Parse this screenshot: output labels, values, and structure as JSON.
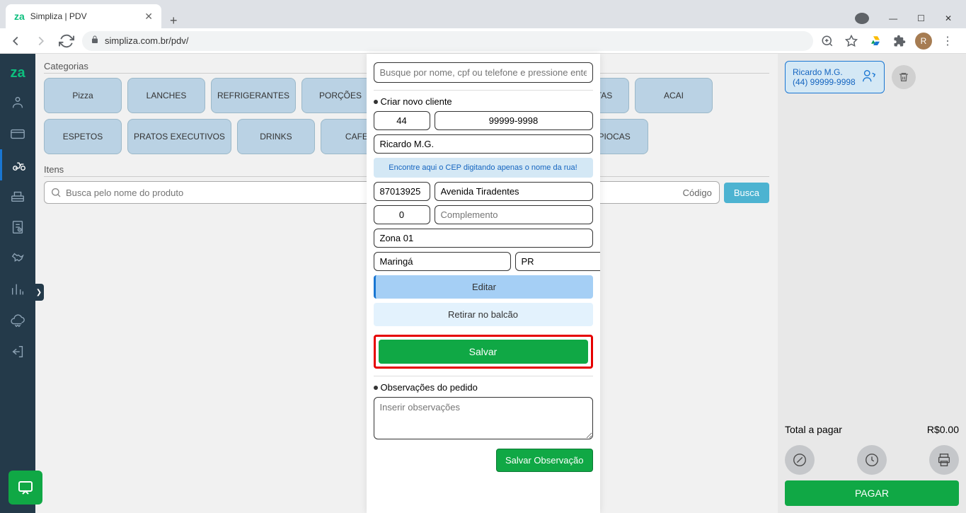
{
  "browser": {
    "tab_title": "Simpliza | PDV",
    "url": "simpliza.com.br/pdv/",
    "profile_letter": "R"
  },
  "sidebar": {
    "items": [
      "logo",
      "pos",
      "card",
      "delivery",
      "register",
      "receipt",
      "handshake",
      "reports",
      "cloud",
      "logout"
    ]
  },
  "main": {
    "categories_label": "Categorias",
    "items_label": "Itens",
    "categories": [
      "Pizza",
      "LANCHES",
      "REFRIGERANTES",
      "PORÇÕES",
      "MARMITAS",
      "ACAI",
      "ESPETOS",
      "PRATOS EXECUTIVOS",
      "DRINKS",
      "CAFES",
      "TAPIOCAS"
    ],
    "search_placeholder": "Busca pelo nome do produto",
    "code_label": "Código",
    "search_btn": "Busca"
  },
  "modal": {
    "search_placeholder": "Busque por nome, cpf ou telefone e pressione enter",
    "new_client_label": "Criar novo cliente",
    "ddd": "44",
    "phone": "99999-9998",
    "name": "Ricardo M.G.",
    "cep_help": "Encontre aqui o CEP digitando apenas o nome da rua!",
    "cep": "87013925",
    "street": "Avenida Tiradentes",
    "number": "0",
    "complement_placeholder": "Complemento",
    "neighborhood": "Zona 01",
    "city": "Maringá",
    "uf": "PR",
    "edit_btn": "Editar",
    "pickup_btn": "Retirar no balcão",
    "save_btn": "Salvar",
    "obs_label": "Observações do pedido",
    "obs_placeholder": "Inserir observações",
    "save_obs_btn": "Salvar Observação"
  },
  "right": {
    "customer_name": "Ricardo M.G.",
    "customer_phone": "(44) 99999-9998",
    "total_label": "Total a pagar",
    "total_value": "R$0.00",
    "pay_btn": "PAGAR"
  }
}
